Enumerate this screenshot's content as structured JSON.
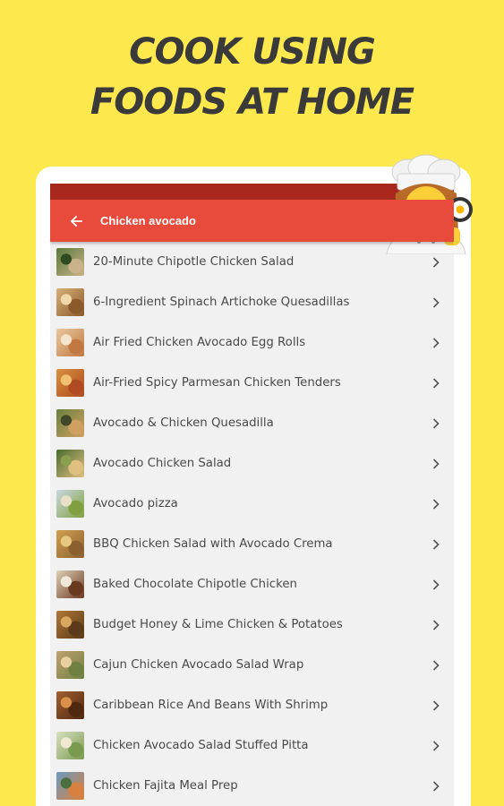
{
  "headline": {
    "line1": "COOK USING",
    "line2": "FOODS AT HOME"
  },
  "appbar": {
    "title": "Chicken avocado",
    "back_icon": "arrow-left-icon",
    "color": "#e84a3b",
    "status_color": "#a8281e"
  },
  "recipes": [
    {
      "label": "20-Minute Chipotle Chicken Salad",
      "thumb": [
        "#5a7a3a",
        "#c9b28a",
        "#2f4a20"
      ]
    },
    {
      "label": "6-Ingredient Spinach Artichoke Quesadillas",
      "thumb": [
        "#d8b078",
        "#8a5a2a",
        "#f1d8a8"
      ]
    },
    {
      "label": "Air Fried Chicken Avocado Egg Rolls",
      "thumb": [
        "#e8c8a0",
        "#c07840",
        "#f4e4cc"
      ]
    },
    {
      "label": "Air-Fried Spicy Parmesan Chicken Tenders",
      "thumb": [
        "#d89040",
        "#b04a20",
        "#f0c070"
      ]
    },
    {
      "label": "Avocado & Chicken Quesadilla",
      "thumb": [
        "#6a8040",
        "#d0a060",
        "#404828"
      ]
    },
    {
      "label": "Avocado Chicken Salad",
      "thumb": [
        "#4a6a30",
        "#e0c080",
        "#8aa050"
      ]
    },
    {
      "label": "Avocado pizza",
      "thumb": [
        "#c8d8e0",
        "#80a040",
        "#e8e0c8"
      ]
    },
    {
      "label": "BBQ Chicken Salad with Avocado Crema",
      "thumb": [
        "#d0a050",
        "#8a6030",
        "#e8c880"
      ]
    },
    {
      "label": "Baked Chocolate Chipotle Chicken",
      "thumb": [
        "#e0d0b8",
        "#6a3a20",
        "#f0e8d8"
      ]
    },
    {
      "label": "Budget Honey & Lime Chicken & Potatoes",
      "thumb": [
        "#b07838",
        "#5a3a18",
        "#d8a860"
      ]
    },
    {
      "label": "Cajun Chicken Avocado Salad Wrap",
      "thumb": [
        "#c0a070",
        "#708040",
        "#e8d0a0"
      ]
    },
    {
      "label": "Caribbean Rice And Beans With Shrimp",
      "thumb": [
        "#a06030",
        "#502810",
        "#d8904a"
      ]
    },
    {
      "label": "Chicken Avocado Salad Stuffed Pitta",
      "thumb": [
        "#d8e0c0",
        "#7a9a50",
        "#f0e8d0"
      ]
    },
    {
      "label": "Chicken Fajita Meal Prep",
      "thumb": [
        "#6a9ac0",
        "#d88040",
        "#4a7040"
      ]
    }
  ],
  "chevron_icon": "chevron-right-icon",
  "mascot": "chef-emoji-icon"
}
